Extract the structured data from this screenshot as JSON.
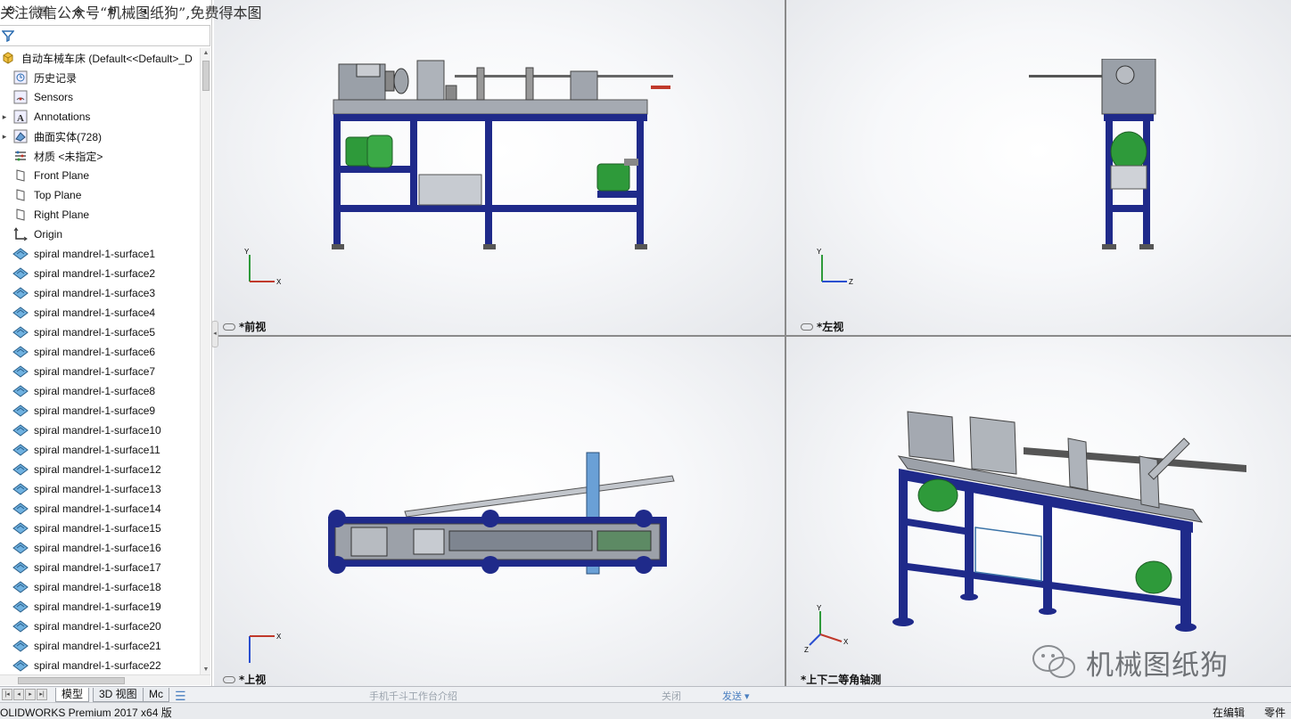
{
  "watermark_top": "关注微信公众号“机械图纸狗”,免费得本图",
  "feature_tree": {
    "root": "自动车械车床  (Default<<Default>_D",
    "items": [
      {
        "label": "历史记录",
        "icon": "history-icon"
      },
      {
        "label": "Sensors",
        "icon": "sensors-icon"
      },
      {
        "label": "Annotations",
        "icon": "annotations-icon"
      },
      {
        "label": "曲面实体(728)",
        "icon": "surface-bodies-icon"
      },
      {
        "label": "材质 <未指定>",
        "icon": "material-icon"
      },
      {
        "label": "Front Plane",
        "icon": "plane-icon"
      },
      {
        "label": "Top Plane",
        "icon": "plane-icon"
      },
      {
        "label": "Right Plane",
        "icon": "plane-icon"
      },
      {
        "label": "Origin",
        "icon": "origin-icon"
      },
      {
        "label": "spiral mandrel-1-surface1",
        "icon": "surface-icon"
      },
      {
        "label": "spiral mandrel-1-surface2",
        "icon": "surface-icon"
      },
      {
        "label": "spiral mandrel-1-surface3",
        "icon": "surface-icon"
      },
      {
        "label": "spiral mandrel-1-surface4",
        "icon": "surface-icon"
      },
      {
        "label": "spiral mandrel-1-surface5",
        "icon": "surface-icon"
      },
      {
        "label": "spiral mandrel-1-surface6",
        "icon": "surface-icon"
      },
      {
        "label": "spiral mandrel-1-surface7",
        "icon": "surface-icon"
      },
      {
        "label": "spiral mandrel-1-surface8",
        "icon": "surface-icon"
      },
      {
        "label": "spiral mandrel-1-surface9",
        "icon": "surface-icon"
      },
      {
        "label": "spiral mandrel-1-surface10",
        "icon": "surface-icon"
      },
      {
        "label": "spiral mandrel-1-surface11",
        "icon": "surface-icon"
      },
      {
        "label": "spiral mandrel-1-surface12",
        "icon": "surface-icon"
      },
      {
        "label": "spiral mandrel-1-surface13",
        "icon": "surface-icon"
      },
      {
        "label": "spiral mandrel-1-surface14",
        "icon": "surface-icon"
      },
      {
        "label": "spiral mandrel-1-surface15",
        "icon": "surface-icon"
      },
      {
        "label": "spiral mandrel-1-surface16",
        "icon": "surface-icon"
      },
      {
        "label": "spiral mandrel-1-surface17",
        "icon": "surface-icon"
      },
      {
        "label": "spiral mandrel-1-surface18",
        "icon": "surface-icon"
      },
      {
        "label": "spiral mandrel-1-surface19",
        "icon": "surface-icon"
      },
      {
        "label": "spiral mandrel-1-surface20",
        "icon": "surface-icon"
      },
      {
        "label": "spiral mandrel-1-surface21",
        "icon": "surface-icon"
      },
      {
        "label": "spiral mandrel-1-surface22",
        "icon": "surface-icon"
      }
    ]
  },
  "viewports": {
    "front": {
      "label": "*前视"
    },
    "left": {
      "label": "*左视"
    },
    "top": {
      "label": "*上视"
    },
    "iso": {
      "label": "*上下二等角轴测"
    }
  },
  "axes": {
    "x": "X",
    "y": "Y",
    "z": "Z"
  },
  "bottom_tabs": [
    "模型",
    "3D 视图",
    "Mc"
  ],
  "ghost_bar": {
    "title": "手机千斗工作台介绍",
    "close": "关闭",
    "send": "发送 ▾"
  },
  "status": {
    "left": "OLIDWORKS Premium 2017 x64 版",
    "editing": "在编辑",
    "doc_type": "零件"
  },
  "brand_watermark": "机械图纸狗",
  "colors": {
    "frame": "#1f2a8a",
    "motor": "#2e9a3a",
    "steel": "#9aa0a8",
    "accent": "#c0392b"
  }
}
